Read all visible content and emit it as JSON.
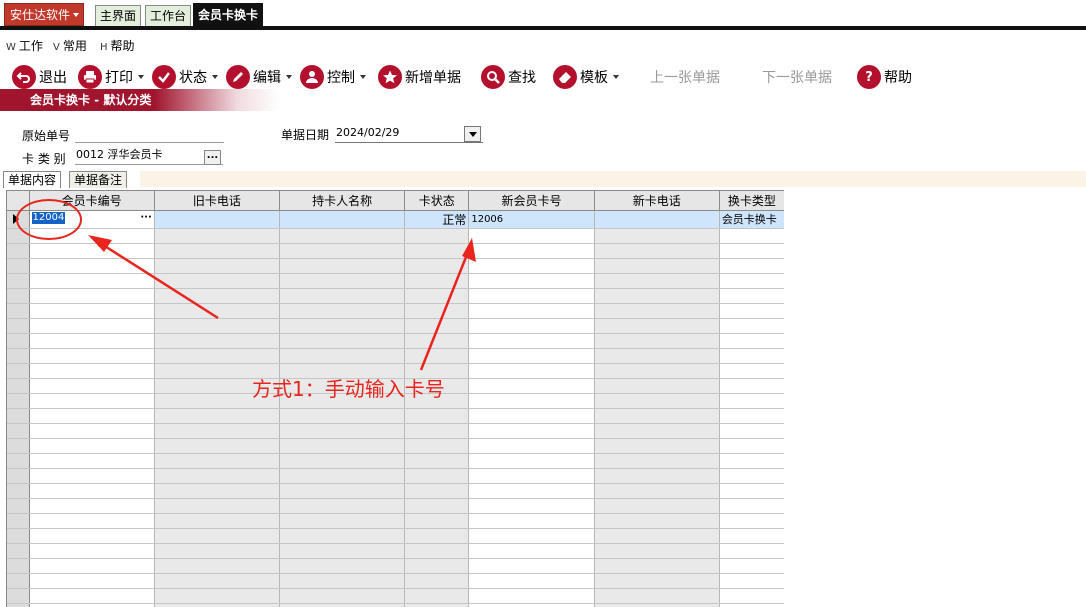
{
  "app": {
    "brand": "安仕达软件",
    "tabs": [
      {
        "label": "主界面",
        "active": false
      },
      {
        "label": "工作台",
        "active": false
      },
      {
        "label": "会员卡换卡",
        "active": true
      }
    ]
  },
  "menu": {
    "items": [
      {
        "key": "W",
        "label": "工作"
      },
      {
        "key": "V",
        "label": "常用"
      },
      {
        "key": "H",
        "label": "帮助"
      }
    ]
  },
  "toolbar": {
    "exit": "退出",
    "print": "打印",
    "status": "状态",
    "edit": "编辑",
    "control": "控制",
    "new_doc": "新增单据",
    "find": "查找",
    "template": "模板",
    "prev": "上一张单据",
    "next": "下一张单据",
    "help": "帮助",
    "help_glyph": "?"
  },
  "form": {
    "title": "会员卡换卡 - 默认分类",
    "orig_no_label": "原始单号",
    "orig_no_value": "",
    "date_label": "单据日期",
    "date_value": "2024/02/29",
    "card_type_label": "卡 类 别",
    "card_type_value": "0012 浮华会员卡",
    "ellipsis": "..."
  },
  "subtabs": [
    {
      "label": "单据内容",
      "active": true
    },
    {
      "label": "单据备注",
      "active": false
    }
  ],
  "grid": {
    "columns": [
      "会员卡编号",
      "旧卡电话",
      "持卡人名称",
      "卡状态",
      "新会员卡号",
      "新卡电话",
      "换卡类型"
    ],
    "rows": [
      {
        "member_card_no": "12004",
        "old_phone": "",
        "holder_name": "",
        "card_status": "正常",
        "new_card_no": "12006",
        "new_phone": "",
        "change_type": "会员卡换卡"
      }
    ],
    "ellipsis": "···"
  },
  "annotation": {
    "text": "方式1：手动输入卡号",
    "color": "#e8251d"
  }
}
